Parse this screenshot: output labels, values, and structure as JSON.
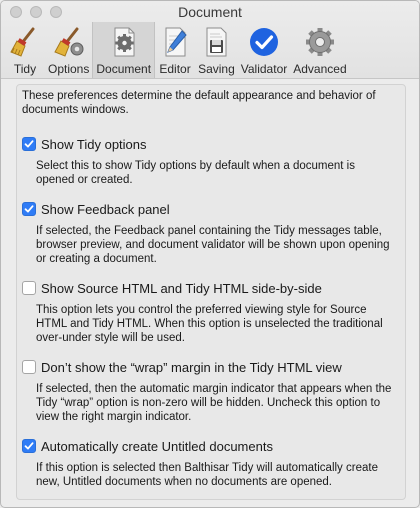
{
  "window": {
    "title": "Document"
  },
  "toolbar": {
    "items": [
      {
        "label": "Tidy",
        "icon": "broom-icon"
      },
      {
        "label": "Options",
        "icon": "broom-gear-icon"
      },
      {
        "label": "Document",
        "icon": "document-gear-icon",
        "selected": true
      },
      {
        "label": "Editor",
        "icon": "pen-document-icon"
      },
      {
        "label": "Saving",
        "icon": "save-document-icon"
      },
      {
        "label": "Validator",
        "icon": "checkmark-circle-icon"
      },
      {
        "label": "Advanced",
        "icon": "gear-icon"
      }
    ]
  },
  "intro": "These preferences determine the default appearance and behavior of documents windows.",
  "options": [
    {
      "label": "Show Tidy options",
      "checked": true,
      "description": "Select this to show Tidy options by default when a document is opened or created."
    },
    {
      "label": "Show Feedback panel",
      "checked": true,
      "description": "If selected, the Feedback panel containing the Tidy messages table, browser preview, and document validator will be shown upon opening or creating a document."
    },
    {
      "label": "Show Source HTML and Tidy HTML side-by-side",
      "checked": false,
      "description": "This option lets you control the preferred viewing style for Source HTML and Tidy HTML. When this option is unselected the traditional over-under style will be used."
    },
    {
      "label": "Don’t show the “wrap” margin in the Tidy HTML view",
      "checked": false,
      "description": "If selected, then the automatic margin indicator that appears when the Tidy “wrap” option is non-zero will be hidden. Uncheck this option to view the right margin indicator."
    },
    {
      "label": "Automatically create Untitled documents",
      "checked": true,
      "description": "If this option is selected then Balthisar Tidy will automatically create new, Untitled documents when no documents are opened."
    }
  ],
  "colors": {
    "accent": "#2f7cf6",
    "validator": "#1f63e0"
  }
}
